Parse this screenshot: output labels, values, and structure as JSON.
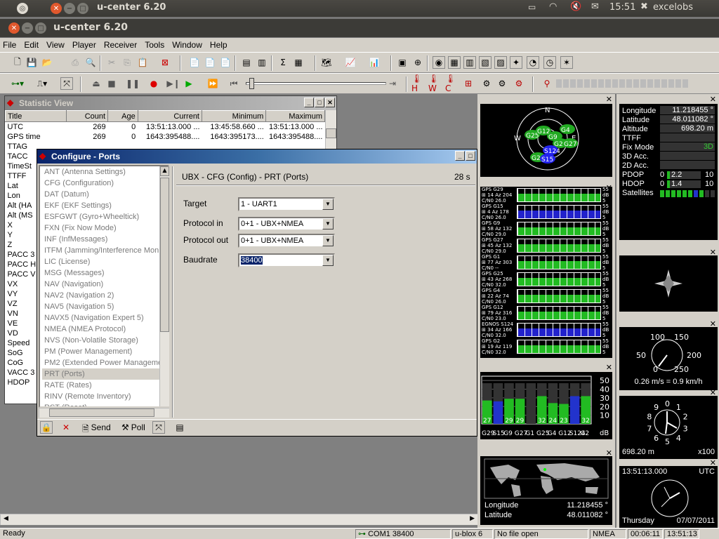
{
  "topbar": {
    "window_title": "u-center 6.20",
    "time": "15:51",
    "user": "excelobs"
  },
  "app": {
    "title": "u-center 6.20"
  },
  "menu": [
    "File",
    "Edit",
    "View",
    "Player",
    "Receiver",
    "Tools",
    "Window",
    "Help"
  ],
  "statistic_view": {
    "title": "Statistic View",
    "columns": [
      "Title",
      "Count",
      "Age",
      "Current",
      "Minimum",
      "Maximum"
    ],
    "rows": [
      [
        "UTC",
        "269",
        "0",
        "13:51:13.000 ...",
        "13:45:58.660 ...",
        "13:51:13.000 ..."
      ],
      [
        "GPS time",
        "269",
        "0",
        "1643:395488....",
        "1643:395173....",
        "1643:395488...."
      ],
      [
        "TTAG",
        "",
        "",
        "",
        "",
        ""
      ],
      [
        "TACC",
        "",
        "",
        "",
        "",
        ""
      ],
      [
        "TimeSt",
        "",
        "",
        "",
        "",
        ""
      ],
      [
        "TTFF",
        "",
        "",
        "",
        "",
        ""
      ],
      [
        "Lat",
        "",
        "",
        "",
        "",
        ""
      ],
      [
        "Lon",
        "",
        "",
        "",
        "",
        ""
      ],
      [
        "Alt (HA",
        "",
        "",
        "",
        "",
        ""
      ],
      [
        "Alt (MS",
        "",
        "",
        "",
        "",
        ""
      ],
      [
        "X",
        "",
        "",
        "",
        "",
        ""
      ],
      [
        "Y",
        "",
        "",
        "",
        "",
        ""
      ],
      [
        "Z",
        "",
        "",
        "",
        "",
        ""
      ],
      [
        "PACC 3",
        "",
        "",
        "",
        "",
        ""
      ],
      [
        "PACC H",
        "",
        "",
        "",
        "",
        ""
      ],
      [
        "PACC V",
        "",
        "",
        "",
        "",
        ""
      ],
      [
        "VX",
        "",
        "",
        "",
        "",
        ""
      ],
      [
        "VY",
        "",
        "",
        "",
        "",
        ""
      ],
      [
        "VZ",
        "",
        "",
        "",
        "",
        ""
      ],
      [
        "VN",
        "",
        "",
        "",
        "",
        ""
      ],
      [
        "VE",
        "",
        "",
        "",
        "",
        ""
      ],
      [
        "VD",
        "",
        "",
        "",
        "",
        ""
      ],
      [
        "Speed",
        "",
        "",
        "",
        "",
        ""
      ],
      [
        "SoG",
        "",
        "",
        "",
        "",
        ""
      ],
      [
        "CoG",
        "",
        "",
        "",
        "",
        ""
      ],
      [
        "VACC 3",
        "",
        "",
        "",
        "",
        ""
      ],
      [
        "HDOP",
        "",
        "",
        "",
        "",
        ""
      ]
    ]
  },
  "configure": {
    "title": "Configure - Ports",
    "list": [
      "ANT (Antenna Settings)",
      "CFG (Configuration)",
      "DAT (Datum)",
      "EKF (EKF Settings)",
      "ESFGWT (Gyro+Wheeltick)",
      "FXN (Fix Now Mode)",
      "INF (InfMessages)",
      "ITFM (Jamming/Interference Monitor)",
      "LIC (License)",
      "MSG (Messages)",
      "NAV (Navigation)",
      "NAV2 (Navigation 2)",
      "NAV5 (Navigation 5)",
      "NAVX5 (Navigation Expert 5)",
      "NMEA (NMEA Protocol)",
      "NVS (Non-Volatile Storage)",
      "PM (Power Management)",
      "PM2 (Extended Power Management)",
      "PRT (Ports)",
      "RATE (Rates)",
      "RINV (Remote Inventory)",
      "RST (Reset)"
    ],
    "selected": "PRT (Ports)",
    "header": "UBX - CFG (Config) - PRT (Ports)",
    "age": "28 s",
    "fields": [
      {
        "label": "Target",
        "value": "1 - UART1"
      },
      {
        "label": "Protocol in",
        "value": "0+1 - UBX+NMEA"
      },
      {
        "label": "Protocol out",
        "value": "0+1 - UBX+NMEA"
      },
      {
        "label": "Baudrate",
        "value": "38400"
      }
    ],
    "send_label": "Send",
    "poll_label": "Poll"
  },
  "sky_view": {
    "north": "N",
    "east": "E",
    "west": "W",
    "sats": [
      "G25",
      "G12",
      "G4",
      "G9",
      "G2",
      "G27",
      "S124",
      "G29",
      "S15"
    ]
  },
  "signal_list": {
    "labels": [
      "GPS G29",
      "⊞ 14 Az 204",
      "C/N0 26.0",
      "GPS G15",
      "⊞ 4 Az 178",
      "C/N0 26.0",
      "GPS G9",
      "⊞ 58 Az 132",
      "C/N0 29.0",
      "GPS G27",
      "⊞ 45 Az 132",
      "C/N0 29.0",
      "GPS G1",
      "⊞ 77 Az 303",
      "C/N0 --",
      "GPS G25",
      "⊞ 43 Az 268",
      "C/N0 32.0",
      "GPS G4",
      "⊞ 22 Az 74",
      "C/N0 26.0",
      "GPS G12",
      "⊞ 79 Az 316",
      "C/N0 23.0",
      "EGNOS S124",
      "⊞ 34 Az 166",
      "C/N0 32.0",
      "GPS G2",
      "⊞ 19 Az 119",
      "C/N0 32.0"
    ],
    "unit_labels": [
      "55",
      "dB",
      "5"
    ]
  },
  "bar_chart": {
    "ylabels": [
      "50",
      "40",
      "30",
      "20",
      "10"
    ],
    "unit": "dB",
    "sats": [
      "G29",
      "S15",
      "G9",
      "G27",
      "G1",
      "G25",
      "G4",
      "G12",
      "S124",
      "G2"
    ],
    "values": [
      27,
      26,
      29,
      29,
      0,
      32,
      24,
      23,
      32,
      32
    ],
    "bar_labels": [
      "27",
      "",
      "29",
      "29",
      "",
      "32",
      "24",
      "23",
      "",
      "32"
    ]
  },
  "world_map": {
    "lon_label": "Longitude",
    "lon": "11.218455 °",
    "lat_label": "Latitude",
    "lat": "48.011082 °"
  },
  "data_view": {
    "rows": [
      {
        "k": "Longitude",
        "v": "11.218455 °"
      },
      {
        "k": "Latitude",
        "v": "48.011082 °"
      },
      {
        "k": "Altitude",
        "v": "698.20 m"
      },
      {
        "k": "TTFF",
        "v": ""
      },
      {
        "k": "Fix Mode",
        "v": "3D"
      },
      {
        "k": "3D Acc.",
        "v": ""
      },
      {
        "k": "2D Acc.",
        "v": ""
      }
    ],
    "pdop": {
      "label": "PDOP",
      "min": "0",
      "val": "2.2",
      "max": "10"
    },
    "hdop": {
      "label": "HDOP",
      "min": "0",
      "val": "1.4",
      "max": "10"
    },
    "sats_label": "Satellites"
  },
  "speed_gauge": {
    "ticks": [
      "0",
      "50",
      "100",
      "150",
      "200",
      "250"
    ],
    "reading": "0.26 m/s = 0.9 km/h"
  },
  "alt_gauge": {
    "ticks": [
      "9",
      "0",
      "1",
      "2",
      "3",
      "4",
      "5",
      "6",
      "7",
      "8"
    ],
    "reading": "698.20 m",
    "multiplier": "x100"
  },
  "clock": {
    "time": "13:51:13.000",
    "tz": "UTC",
    "day": "Thursday",
    "date": "07/07/2011"
  },
  "status": {
    "ready": "Ready",
    "port": "COM1 38400",
    "device": "u-blox 6",
    "file": "No file open",
    "protocol": "NMEA",
    "elapsed": "00:06:11",
    "time": "13:51:13"
  }
}
